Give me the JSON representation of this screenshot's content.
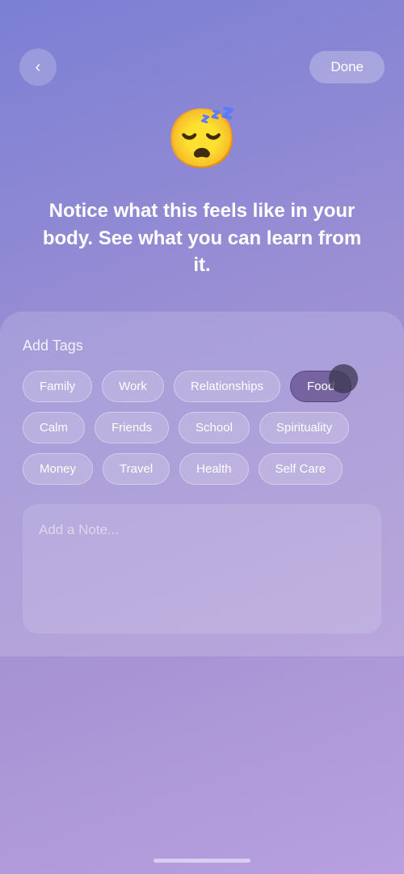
{
  "header": {
    "back_label": "‹",
    "done_label": "Done"
  },
  "emoji": "😴",
  "main_text": "Notice what this feels like in your body. See what you can learn from it.",
  "tags_section": {
    "label": "Add Tags",
    "tags": [
      {
        "id": "family",
        "label": "Family",
        "selected": false
      },
      {
        "id": "work",
        "label": "Work",
        "selected": false
      },
      {
        "id": "relationships",
        "label": "Relationships",
        "selected": false
      },
      {
        "id": "food",
        "label": "Food",
        "selected": true
      },
      {
        "id": "calm",
        "label": "Calm",
        "selected": false
      },
      {
        "id": "friends",
        "label": "Friends",
        "selected": false
      },
      {
        "id": "school",
        "label": "School",
        "selected": false
      },
      {
        "id": "spirituality",
        "label": "Spirituality",
        "selected": false
      },
      {
        "id": "money",
        "label": "Money",
        "selected": false
      },
      {
        "id": "travel",
        "label": "Travel",
        "selected": false
      },
      {
        "id": "health",
        "label": "Health",
        "selected": false
      },
      {
        "id": "self-care",
        "label": "Self Care",
        "selected": false
      }
    ]
  },
  "note_section": {
    "placeholder": "Add a Note..."
  }
}
